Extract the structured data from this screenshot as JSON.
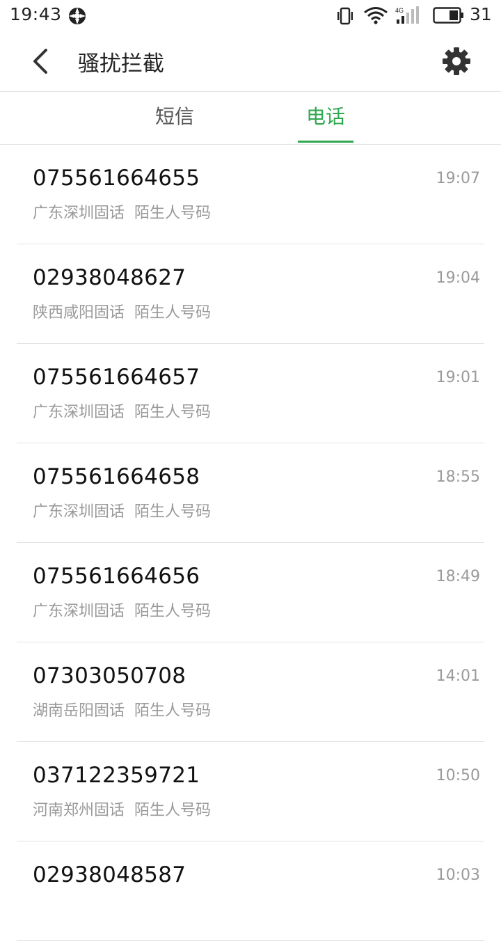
{
  "status_bar": {
    "time": "19:43",
    "battery_level": "31",
    "icons": [
      "app-notification-icon",
      "vibrate-icon",
      "wifi-icon",
      "signal-4g-icon",
      "battery-icon"
    ]
  },
  "header": {
    "title": "骚扰拦截",
    "back_icon": "back-icon",
    "settings_icon": "gear-icon"
  },
  "tabs": [
    {
      "label": "短信",
      "active": false
    },
    {
      "label": "电话",
      "active": true
    }
  ],
  "colors": {
    "accent": "#2fa84f",
    "secondary_text": "#9a9a9a",
    "divider": "#e3e3e3"
  },
  "calls": [
    {
      "number": "075561664655",
      "location": "广东深圳固话",
      "tag": "陌生人号码",
      "time": "19:07"
    },
    {
      "number": "02938048627",
      "location": "陕西咸阳固话",
      "tag": "陌生人号码",
      "time": "19:04"
    },
    {
      "number": "075561664657",
      "location": "广东深圳固话",
      "tag": "陌生人号码",
      "time": "19:01"
    },
    {
      "number": "075561664658",
      "location": "广东深圳固话",
      "tag": "陌生人号码",
      "time": "18:55"
    },
    {
      "number": "075561664656",
      "location": "广东深圳固话",
      "tag": "陌生人号码",
      "time": "18:49"
    },
    {
      "number": "07303050708",
      "location": "湖南岳阳固话",
      "tag": "陌生人号码",
      "time": "14:01"
    },
    {
      "number": "037122359721",
      "location": "河南郑州固话",
      "tag": "陌生人号码",
      "time": "10:50"
    },
    {
      "number": "02938048587",
      "location": "",
      "tag": "",
      "time": "10:03"
    }
  ]
}
